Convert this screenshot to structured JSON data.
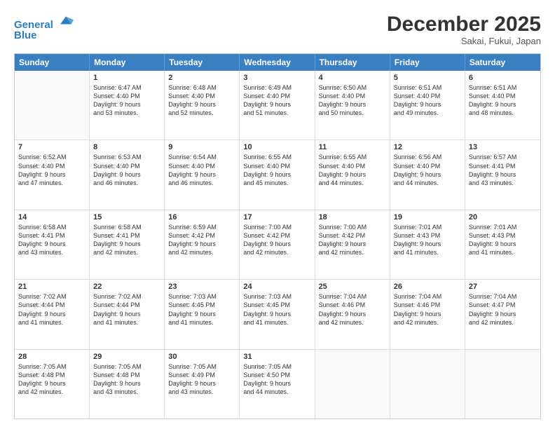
{
  "header": {
    "logo_line1": "General",
    "logo_line2": "Blue",
    "month": "December 2025",
    "location": "Sakai, Fukui, Japan"
  },
  "days_of_week": [
    "Sunday",
    "Monday",
    "Tuesday",
    "Wednesday",
    "Thursday",
    "Friday",
    "Saturday"
  ],
  "weeks": [
    [
      {
        "day": "",
        "empty": true
      },
      {
        "day": "1",
        "sr": "6:47 AM",
        "ss": "4:40 PM",
        "dl": "9 hours and 53 minutes."
      },
      {
        "day": "2",
        "sr": "6:48 AM",
        "ss": "4:40 PM",
        "dl": "9 hours and 52 minutes."
      },
      {
        "day": "3",
        "sr": "6:49 AM",
        "ss": "4:40 PM",
        "dl": "9 hours and 51 minutes."
      },
      {
        "day": "4",
        "sr": "6:50 AM",
        "ss": "4:40 PM",
        "dl": "9 hours and 50 minutes."
      },
      {
        "day": "5",
        "sr": "6:51 AM",
        "ss": "4:40 PM",
        "dl": "9 hours and 49 minutes."
      },
      {
        "day": "6",
        "sr": "6:51 AM",
        "ss": "4:40 PM",
        "dl": "9 hours and 48 minutes."
      }
    ],
    [
      {
        "day": "7",
        "sr": "6:52 AM",
        "ss": "4:40 PM",
        "dl": "9 hours and 47 minutes."
      },
      {
        "day": "8",
        "sr": "6:53 AM",
        "ss": "4:40 PM",
        "dl": "9 hours and 46 minutes."
      },
      {
        "day": "9",
        "sr": "6:54 AM",
        "ss": "4:40 PM",
        "dl": "9 hours and 46 minutes."
      },
      {
        "day": "10",
        "sr": "6:55 AM",
        "ss": "4:40 PM",
        "dl": "9 hours and 45 minutes."
      },
      {
        "day": "11",
        "sr": "6:55 AM",
        "ss": "4:40 PM",
        "dl": "9 hours and 44 minutes."
      },
      {
        "day": "12",
        "sr": "6:56 AM",
        "ss": "4:40 PM",
        "dl": "9 hours and 44 minutes."
      },
      {
        "day": "13",
        "sr": "6:57 AM",
        "ss": "4:41 PM",
        "dl": "9 hours and 43 minutes."
      }
    ],
    [
      {
        "day": "14",
        "sr": "6:58 AM",
        "ss": "4:41 PM",
        "dl": "9 hours and 43 minutes."
      },
      {
        "day": "15",
        "sr": "6:58 AM",
        "ss": "4:41 PM",
        "dl": "9 hours and 42 minutes."
      },
      {
        "day": "16",
        "sr": "6:59 AM",
        "ss": "4:42 PM",
        "dl": "9 hours and 42 minutes."
      },
      {
        "day": "17",
        "sr": "7:00 AM",
        "ss": "4:42 PM",
        "dl": "9 hours and 42 minutes."
      },
      {
        "day": "18",
        "sr": "7:00 AM",
        "ss": "4:42 PM",
        "dl": "9 hours and 42 minutes."
      },
      {
        "day": "19",
        "sr": "7:01 AM",
        "ss": "4:43 PM",
        "dl": "9 hours and 41 minutes."
      },
      {
        "day": "20",
        "sr": "7:01 AM",
        "ss": "4:43 PM",
        "dl": "9 hours and 41 minutes."
      }
    ],
    [
      {
        "day": "21",
        "sr": "7:02 AM",
        "ss": "4:44 PM",
        "dl": "9 hours and 41 minutes."
      },
      {
        "day": "22",
        "sr": "7:02 AM",
        "ss": "4:44 PM",
        "dl": "9 hours and 41 minutes."
      },
      {
        "day": "23",
        "sr": "7:03 AM",
        "ss": "4:45 PM",
        "dl": "9 hours and 41 minutes."
      },
      {
        "day": "24",
        "sr": "7:03 AM",
        "ss": "4:45 PM",
        "dl": "9 hours and 41 minutes."
      },
      {
        "day": "25",
        "sr": "7:04 AM",
        "ss": "4:46 PM",
        "dl": "9 hours and 42 minutes."
      },
      {
        "day": "26",
        "sr": "7:04 AM",
        "ss": "4:46 PM",
        "dl": "9 hours and 42 minutes."
      },
      {
        "day": "27",
        "sr": "7:04 AM",
        "ss": "4:47 PM",
        "dl": "9 hours and 42 minutes."
      }
    ],
    [
      {
        "day": "28",
        "sr": "7:05 AM",
        "ss": "4:48 PM",
        "dl": "9 hours and 42 minutes."
      },
      {
        "day": "29",
        "sr": "7:05 AM",
        "ss": "4:48 PM",
        "dl": "9 hours and 43 minutes."
      },
      {
        "day": "30",
        "sr": "7:05 AM",
        "ss": "4:49 PM",
        "dl": "9 hours and 43 minutes."
      },
      {
        "day": "31",
        "sr": "7:05 AM",
        "ss": "4:50 PM",
        "dl": "9 hours and 44 minutes."
      },
      {
        "day": "",
        "empty": true
      },
      {
        "day": "",
        "empty": true
      },
      {
        "day": "",
        "empty": true
      }
    ]
  ],
  "labels": {
    "sunrise": "Sunrise:",
    "sunset": "Sunset:",
    "daylight": "Daylight:"
  }
}
